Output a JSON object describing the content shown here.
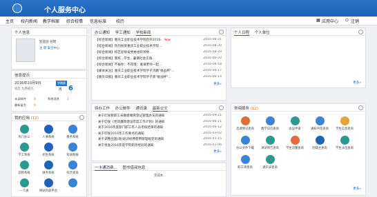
{
  "header": {
    "logo_text": "",
    "title": "个人服务中心"
  },
  "nav": {
    "items": [
      "主页",
      "校内新闻",
      "教学档案",
      "综合校情",
      "信息标准",
      "校历"
    ],
    "app_center": "应用中心",
    "logout": "注销"
  },
  "user": {
    "header": "个人信息",
    "welcome": "欢迎您 付瑶",
    "links": "注 销   安全中心"
  },
  "info": {
    "header": "信息提示",
    "date": "2016年10月9日",
    "lunar": "农历 九月初九",
    "week_badge": "学期周",
    "week_num": "6",
    "week_unit": "周",
    "labels": [
      "未读邮件",
      "系统消息",
      "最新留言"
    ],
    "counts": [
      "0",
      "1",
      "0"
    ]
  },
  "apps": {
    "header": "我的应用",
    "count": "(12)",
    "items": [
      "热门办公",
      "人事系统",
      "教务系统",
      "学工系统",
      "招生系统",
      "科研系统",
      "迎新系统",
      "财务系统",
      "综合查询",
      "一卡通",
      "网站内容平台",
      "..."
    ]
  },
  "news": {
    "tabs": [
      "办公通知",
      "学工通知",
      "学校新闻"
    ],
    "rows": [
      {
        "t": "·【综合新闻】重庆工业职业技术学院召开2016-",
        "d": "2016-08-31",
        "new": "New"
      },
      {
        "t": "·【综合新闻】热烈祝贺重庆工业职业技术学院...",
        "d": "2016-08-30",
        "new": ""
      },
      {
        "t": "·【综合新闻】校区迎接省党委组织领导...",
        "d": "2016-08-29",
        "new": ""
      },
      {
        "t": "·【综合新闻】我校...学生...暑期社会实践...",
        "d": "2016-06-20",
        "new": ""
      },
      {
        "t": "·【综合新闻】不拔你：不得落；邀请老师一起...",
        "d": "2016-06-18",
        "new": ""
      },
      {
        "t": "·【媒体关注】重庆工业职业技术学院学子鸿鹏\"挑战杯\"...",
        "d": "2016-06-17",
        "new": ""
      },
      {
        "t": "·【重庆日报】重庆工业职业技术学院学子获\"挑战杯\"...",
        "d": "2016-06-14",
        "new": ""
      }
    ],
    "more": "更多»"
  },
  "todo": {
    "tabs": [
      "待办工作",
      "办公邮件",
      "通讯录",
      "最新公文"
    ],
    "rows": [
      {
        "t": "· 关于印发教职工未婚者婚育登记管理办法的通知",
        "d": "2016-09-21"
      },
      {
        "t": "· 关于印发《党风廉政建设年度工作计划》的通知",
        "d": "2016-06-21"
      },
      {
        "t": "· 关于2016年度部门职工年人员考核结果的通知",
        "d": "2016-06-12"
      },
      {
        "t": "· 关于印发2016年工作要点的通知",
        "d": "2016-03-02"
      },
      {
        "t": "· 关于调整出国(境)培训经费使用管理规定的通知",
        "d": "2016-01-15"
      },
      {
        "t": "· 关于批准2016年度学院职务经验的通知",
        "d": "2016-01-06"
      }
    ],
    "more": "更多»"
  },
  "schedule": {
    "tabs": [
      "个人日程",
      "个人单位"
    ],
    "more": "更多»"
  },
  "services": {
    "header": "常用服务",
    "count": "(12)",
    "items": [
      "选课情况查询",
      "教学日历查询",
      "会议申请",
      "通知书签查询",
      "学生信息查询",
      "办公文件下载",
      "讲试师告查询",
      "学生流量查询",
      "团辅主查询",
      "学生派位查询",
      "职工请查询",
      "通讯录查询"
    ],
    "more": "更多»"
  },
  "bottom": {
    "tabs": [
      "一卡通消费...",
      "图书借阅信息"
    ],
    "text": "完成本..."
  }
}
